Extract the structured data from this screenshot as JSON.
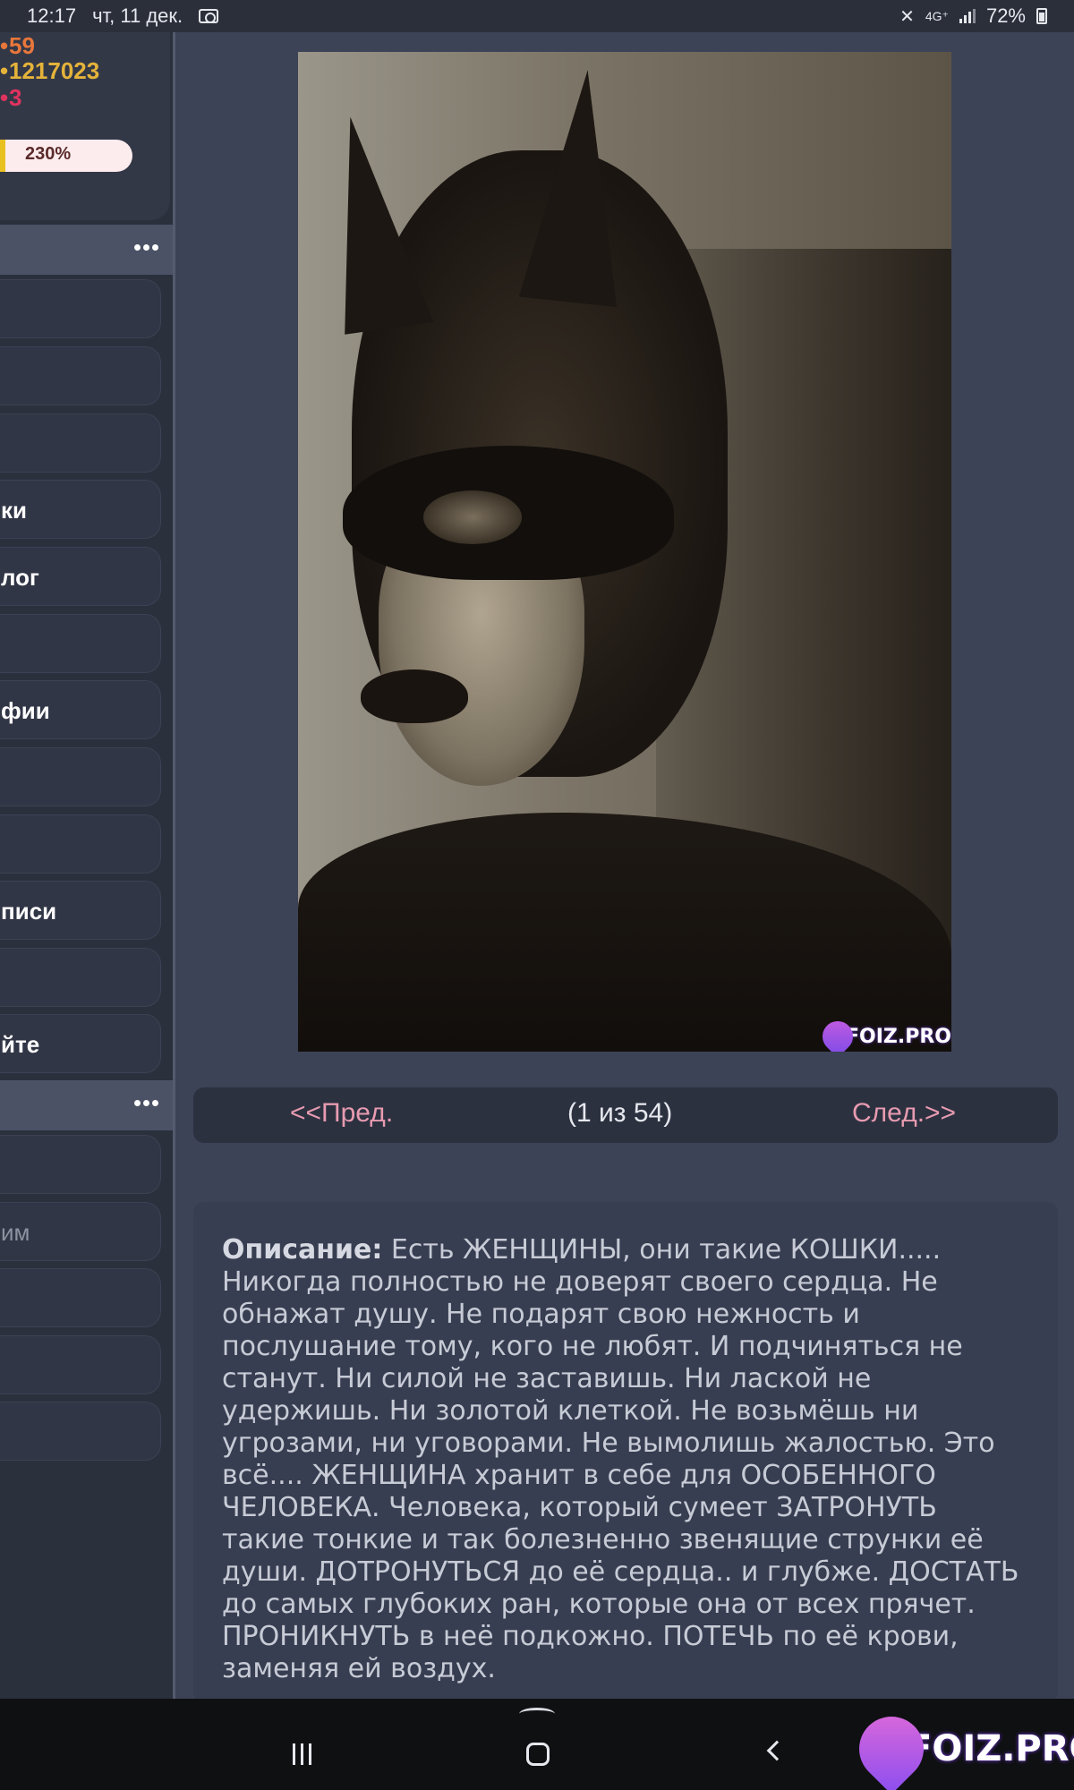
{
  "status_bar": {
    "time": "12:17",
    "date": "чт, 11 дек.",
    "network": "4G⁺",
    "battery": "72%"
  },
  "sidebar": {
    "stats": {
      "value1": "59",
      "value2": "1217023",
      "value3": "3"
    },
    "progress": {
      "label": "230%"
    },
    "menu1": [
      {
        "label": ""
      },
      {
        "label": ""
      },
      {
        "label": ""
      },
      {
        "label": "ки"
      },
      {
        "label": "лог"
      },
      {
        "label": ""
      },
      {
        "label": "фии"
      },
      {
        "label": ""
      },
      {
        "label": ""
      },
      {
        "label": "писи"
      },
      {
        "label": ""
      },
      {
        "label": "йте"
      }
    ],
    "menu2": [
      {
        "label": ""
      },
      {
        "label": "им"
      },
      {
        "label": ""
      },
      {
        "label": ""
      },
      {
        "label": ""
      }
    ]
  },
  "content": {
    "image_watermark": "FOIZ.PRO",
    "pager": {
      "prev": "<<Пред.",
      "count": "(1 из 54)",
      "next": "След.>>"
    },
    "description": {
      "label": "Описание:",
      "text": " Есть ЖЕНЩИНЫ, они такие КОШКИ..... Никогда полностью не доверят своего сердца. Не обнажат душу. Не подарят свою нежность и послушание тому, кого не любят. И подчиняться не станут. Ни силой не заставишь. Ни лаской не удержишь. Ни золотой клеткой. Не возьмёшь ни угрозами, ни уговорами. Не вымолишь жалостью. Это всё.... ЖЕНЩИНА хранит в себе для ОСОБЕННОГО ЧЕЛОВЕКА. Человека, который сумеет ЗАТРОНУТЬ такие тонкие и так болезненно звенящие струнки её души. ДОТРОНУТЬСЯ до её сердца.. и глубже. ДОСТАТЬ до самых глубоких ран, которые она от всех прячет. ПРОНИКНУТЬ в неё подкожно. ПОТЕЧЬ по её крови, заменяя ей воздух."
    }
  },
  "brand_watermark": "FOIZ.PRO"
}
